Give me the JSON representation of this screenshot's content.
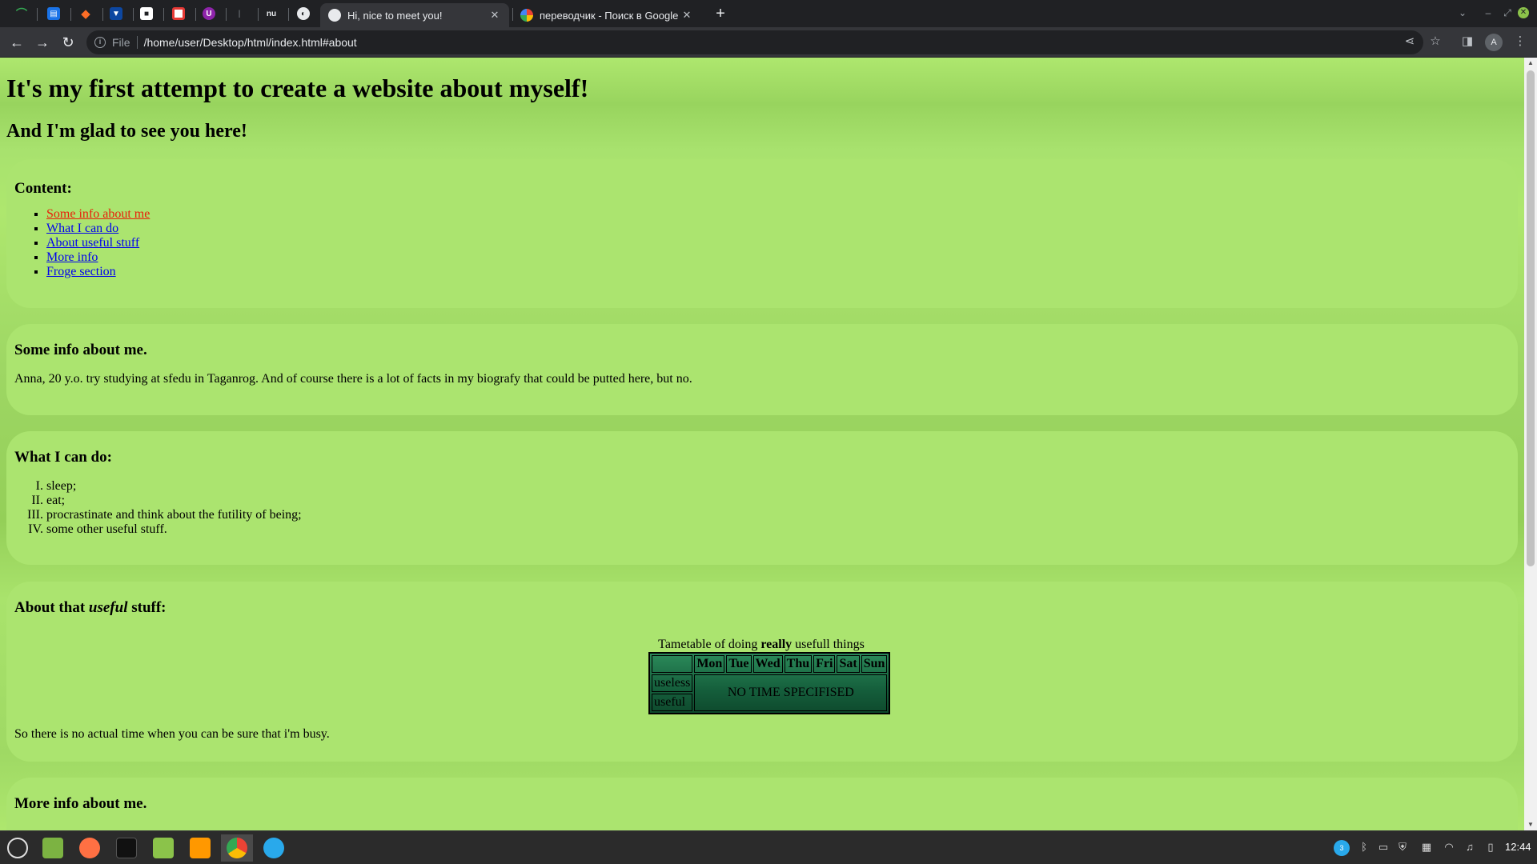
{
  "browser": {
    "tabs": [
      {
        "title": "Hi, nice to meet you!",
        "active": true
      },
      {
        "title": "переводчик - Поиск в Google",
        "active": false
      }
    ],
    "pinned_tabs": [
      "openproject-icon",
      "book-icon",
      "gitlab-icon",
      "bitbucket-icon",
      "chat-icon",
      "youtube-icon",
      "ublock-icon",
      "dash-icon",
      "nu-icon",
      "globe-icon"
    ],
    "pinned_nu_label": "nu",
    "new_tab_symbol": "+",
    "address": {
      "scheme": "File",
      "url": "/home/user/Desktop/html/index.html#about"
    },
    "profile_initial": "A"
  },
  "page": {
    "h1": "It's my first attempt to create a website about myself!",
    "h2": "And I'm glad to see you here!",
    "content": {
      "heading": "Content:",
      "links": [
        "Some info about me",
        "What I can do",
        "About useful stuff",
        "More info",
        "Froge section"
      ]
    },
    "about": {
      "heading": "Some info about me.",
      "text": "Anna, 20 y.o. try studying at sfedu in Taganrog. And of course there is a lot of facts in my biografy that could be putted here, but no."
    },
    "cando": {
      "heading": "What I can do:",
      "items": [
        "sleep;",
        "eat;",
        "procrastinate and think about the futility of being;",
        "some other useful stuff."
      ]
    },
    "useful": {
      "heading_pre": "About that ",
      "heading_em": "useful",
      "heading_post": " stuff:",
      "caption_pre": "Tametable of doing ",
      "caption_bold": "really",
      "caption_post": " usefull things",
      "days": [
        "Mon",
        "Tue",
        "Wed",
        "Thu",
        "Fri",
        "Sat",
        "Sun"
      ],
      "rows": [
        "useless",
        "useful"
      ],
      "cell_text": "NO TIME SPECIFISED",
      "footer": "So there is no actual time when you can be sure that i'm busy."
    },
    "more": {
      "heading": "More info about me."
    }
  },
  "taskbar": {
    "clock": "12:44",
    "notification_count": "3"
  },
  "colors": {
    "page_bg": "#aee76e",
    "card_bg": "#abe46f",
    "link": "#0000ee",
    "link_hover": "#e8200a",
    "table_top": "#2b8a5a",
    "table_bottom": "#0e4a2d"
  }
}
